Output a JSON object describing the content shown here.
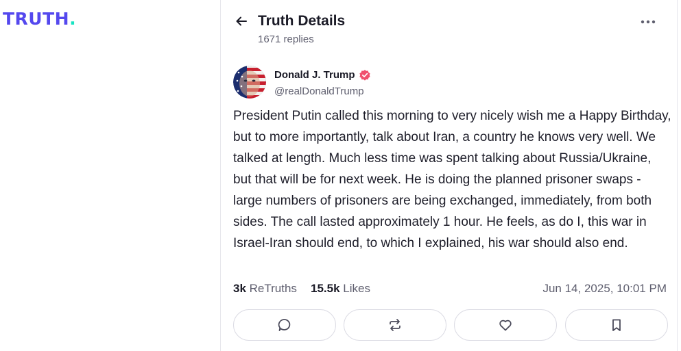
{
  "brand": {
    "logo_word": "TRUTH",
    "logo_dot": ".",
    "colors": {
      "primary": "#5448ee",
      "accent": "#17e3c2",
      "verified": "#f0506e"
    }
  },
  "header": {
    "back_icon": "arrow-left-icon",
    "title": "Truth Details",
    "subtitle": "1671 replies",
    "more_icon": "more-horizontal-icon"
  },
  "post": {
    "author": {
      "name": "Donald J. Trump",
      "handle": "@realDonaldTrump",
      "verified_icon": "verified-badge-icon"
    },
    "text": "President Putin called this morning to very nicely wish me a Happy Birthday, but to more importantly, talk about Iran, a country he knows very well. We talked at length. Much less time was spent talking about Russia/Ukraine, but that will be for next week. He is doing the planned prisoner swaps - large numbers of prisoners are being exchanged, immediately, from both sides. The call lasted approximately 1 hour. He feels, as do I, this war in Israel-Iran should end, to which I explained, his war should also end.",
    "stats": {
      "retruths_count": "3k",
      "retruths_label": "ReTruths",
      "likes_count": "15.5k",
      "likes_label": "Likes",
      "timestamp": "Jun 14, 2025, 10:01 PM"
    },
    "actions": [
      {
        "name": "reply",
        "icon": "reply-bubble-icon"
      },
      {
        "name": "retruth",
        "icon": "retruth-arrows-icon"
      },
      {
        "name": "like",
        "icon": "heart-icon"
      },
      {
        "name": "bookmark",
        "icon": "bookmark-icon"
      }
    ]
  }
}
